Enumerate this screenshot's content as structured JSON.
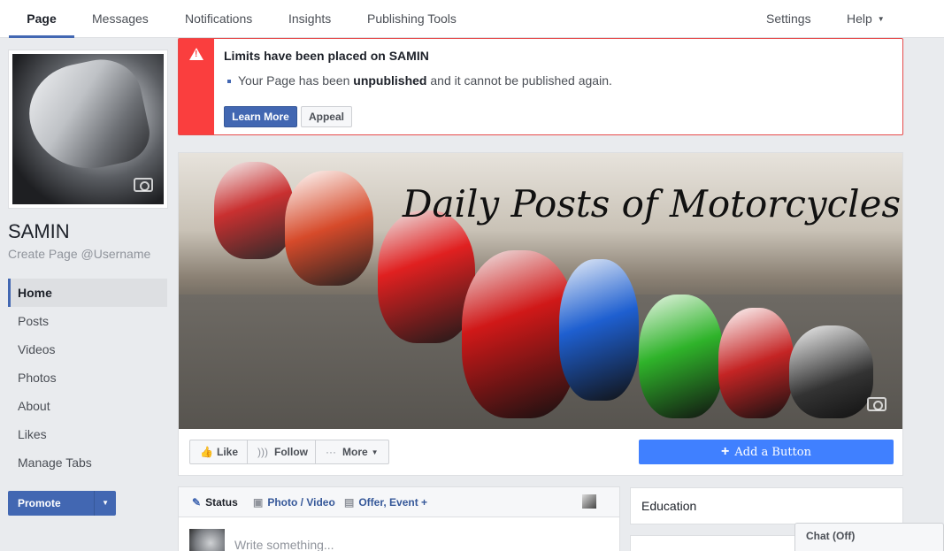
{
  "topnav": {
    "tabs": [
      {
        "label": "Page",
        "active": true
      },
      {
        "label": "Messages"
      },
      {
        "label": "Notifications"
      },
      {
        "label": "Insights"
      },
      {
        "label": "Publishing Tools"
      }
    ],
    "settings": "Settings",
    "help": "Help"
  },
  "profile": {
    "name": "SAMIN",
    "username_link": "Create Page @Username"
  },
  "leftnav": {
    "items": [
      {
        "label": "Home",
        "active": true
      },
      {
        "label": "Posts"
      },
      {
        "label": "Videos"
      },
      {
        "label": "Photos"
      },
      {
        "label": "About"
      },
      {
        "label": "Likes"
      },
      {
        "label": "Manage Tabs"
      }
    ],
    "promote": "Promote"
  },
  "alert": {
    "title": "Limits have been placed on SAMIN",
    "msg_prefix": "Your Page has been ",
    "msg_bold": "unpublished",
    "msg_suffix": " and it cannot be published again.",
    "learn_more": "Learn More",
    "appeal": "Appeal"
  },
  "cover": {
    "title": "Daily Posts of Motorcycles",
    "like": "Like",
    "follow": "Follow",
    "more": "More",
    "add_button": "Add a Button"
  },
  "composer": {
    "status": "Status",
    "photo_video": "Photo / Video",
    "offer_event": "Offer, Event +",
    "placeholder": "Write something..."
  },
  "sidebar": {
    "education": "Education"
  },
  "chat": {
    "label": "Chat (Off)"
  },
  "colors": {
    "accent": "#4267b2",
    "alert": "#fa3e3e",
    "add_button": "#4080ff",
    "background": "#e9ebee"
  },
  "icons": {
    "alert": "warning-icon",
    "camera": "camera-icon",
    "like": "thumbs-up-icon",
    "follow": "rss-icon",
    "more": "ellipsis-icon",
    "status": "pencil-icon",
    "photo": "camera-icon",
    "offer": "offer-icon"
  }
}
